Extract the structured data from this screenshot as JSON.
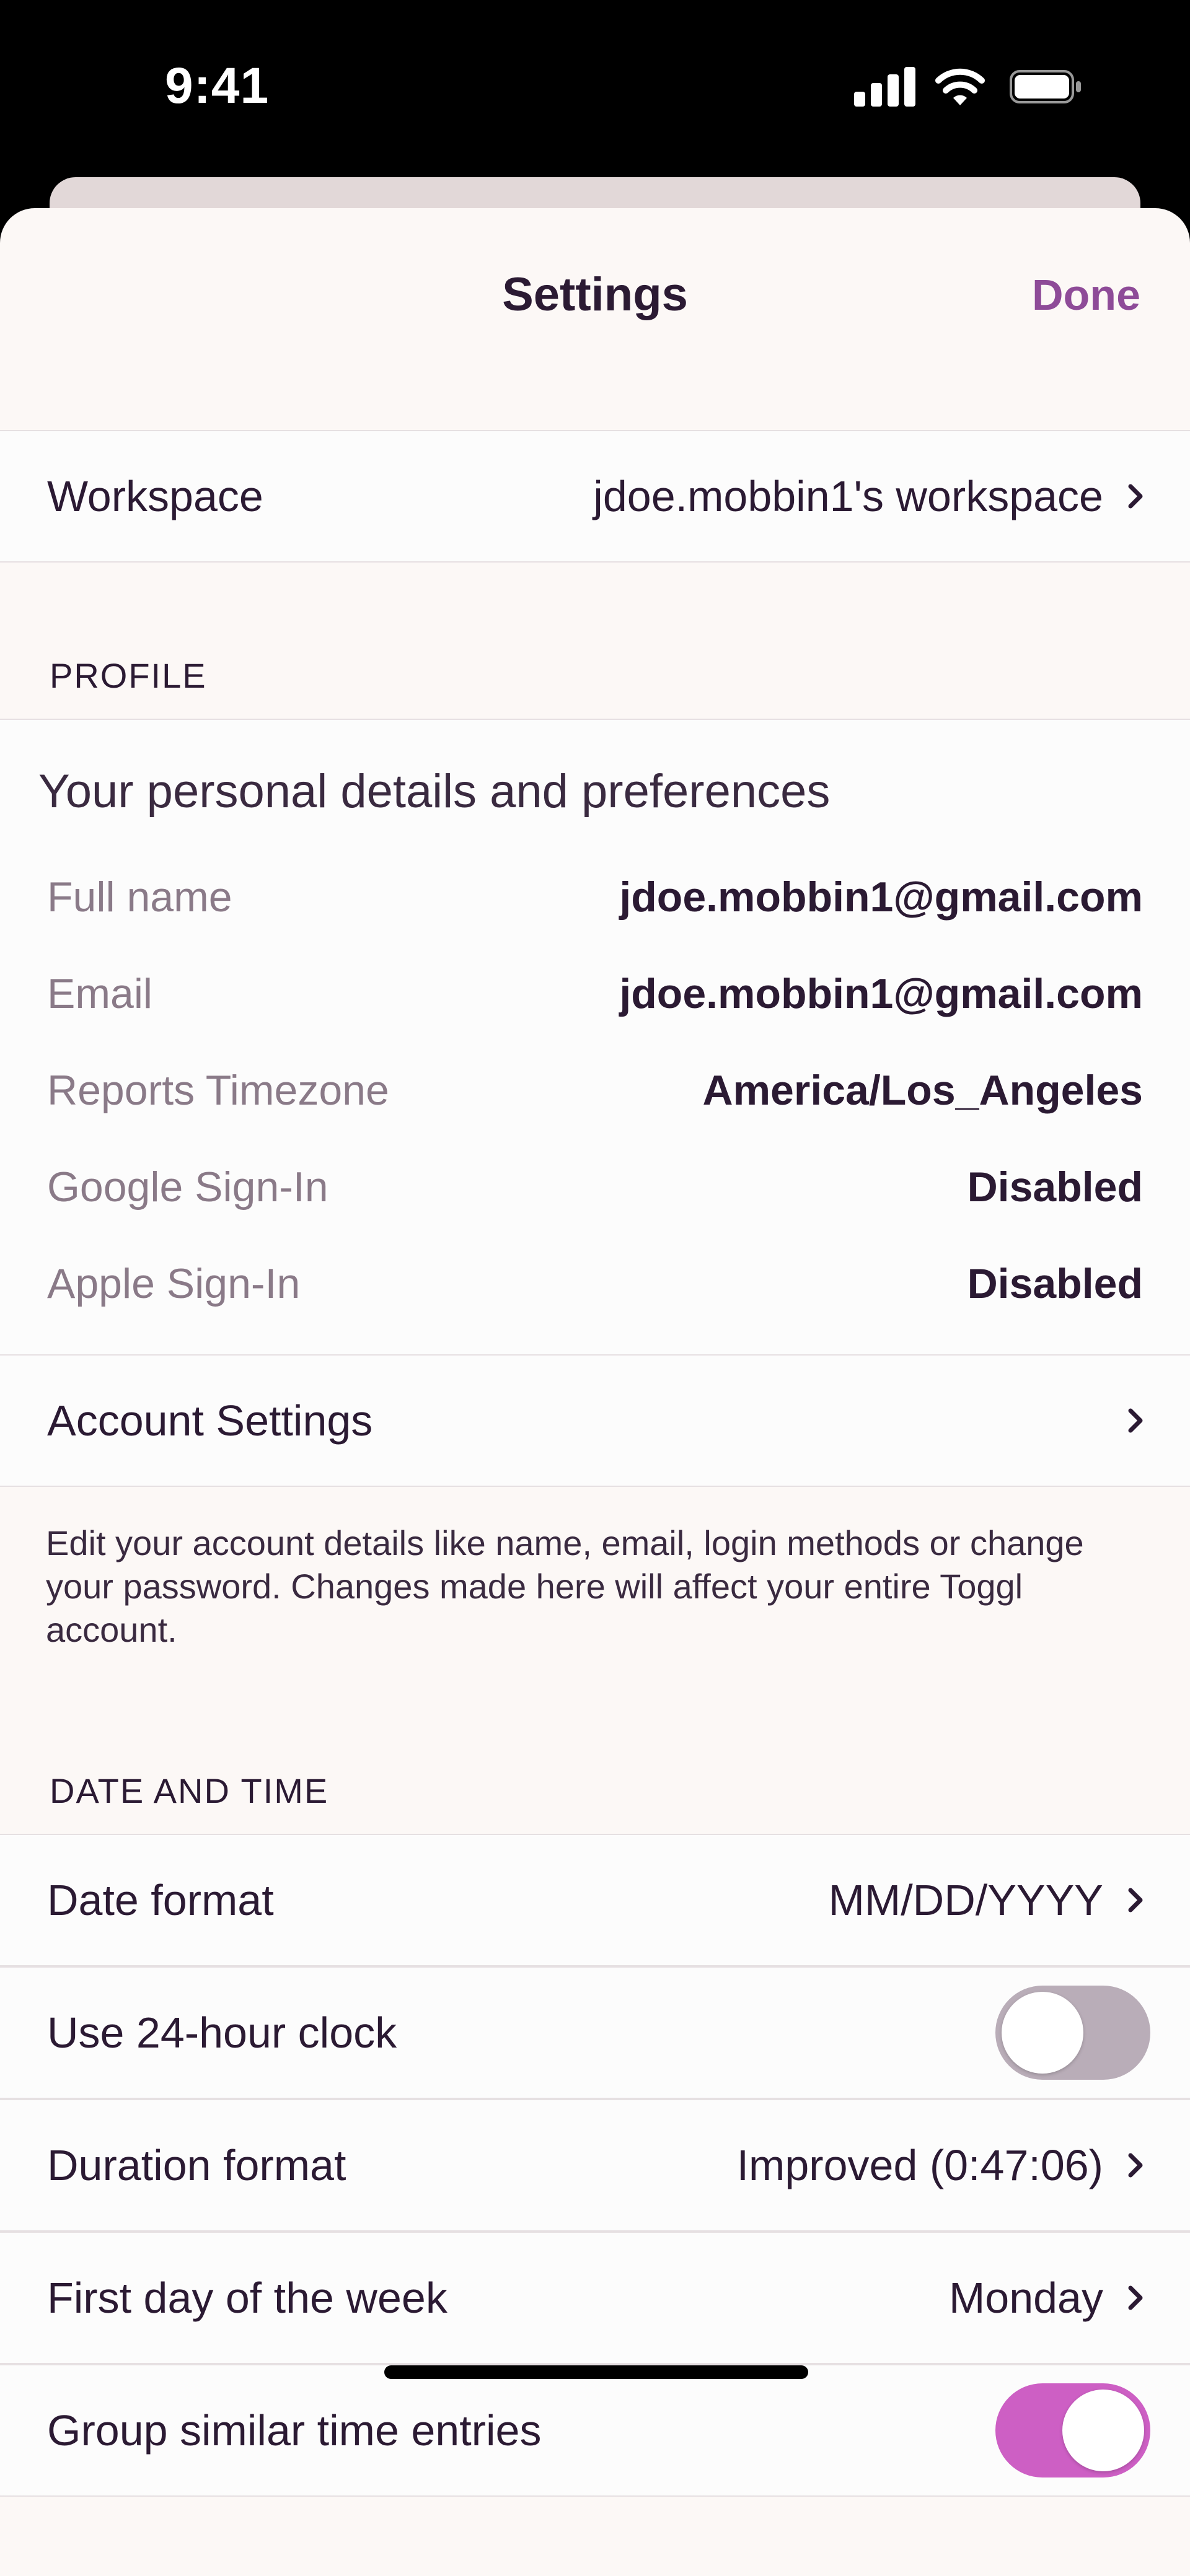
{
  "status_bar": {
    "time": "9:41"
  },
  "header": {
    "title": "Settings",
    "done_label": "Done"
  },
  "workspace": {
    "label": "Workspace",
    "value": "jdoe.mobbin1's workspace"
  },
  "profile": {
    "section_title": "PROFILE",
    "heading": "Your personal details and preferences",
    "fields": [
      {
        "label": "Full name",
        "value": "jdoe.mobbin1@gmail.com"
      },
      {
        "label": "Email",
        "value": "jdoe.mobbin1@gmail.com"
      },
      {
        "label": "Reports Timezone",
        "value": "America/Los_Angeles"
      },
      {
        "label": "Google Sign-In",
        "value": "Disabled"
      },
      {
        "label": "Apple Sign-In",
        "value": "Disabled"
      }
    ],
    "account_settings_label": "Account Settings",
    "footnote": "Edit your account details like name, email, login methods or change your password. Changes made here will affect your entire Toggl account."
  },
  "date_time": {
    "section_title": "DATE AND TIME",
    "date_format": {
      "label": "Date format",
      "value": "MM/DD/YYYY"
    },
    "clock_24h": {
      "label": "Use 24-hour clock",
      "on": false
    },
    "duration_format": {
      "label": "Duration format",
      "value": "Improved (0:47:06)"
    },
    "first_day": {
      "label": "First day of the week",
      "value": "Monday"
    },
    "group_similar": {
      "label": "Group similar time entries",
      "on": true
    }
  },
  "colors": {
    "accent": "#8e4b98",
    "toggle_on": "#cd5fc4",
    "toggle_off": "#b9adb8"
  },
  "icons": {
    "chevron": "chevron-right-icon"
  }
}
